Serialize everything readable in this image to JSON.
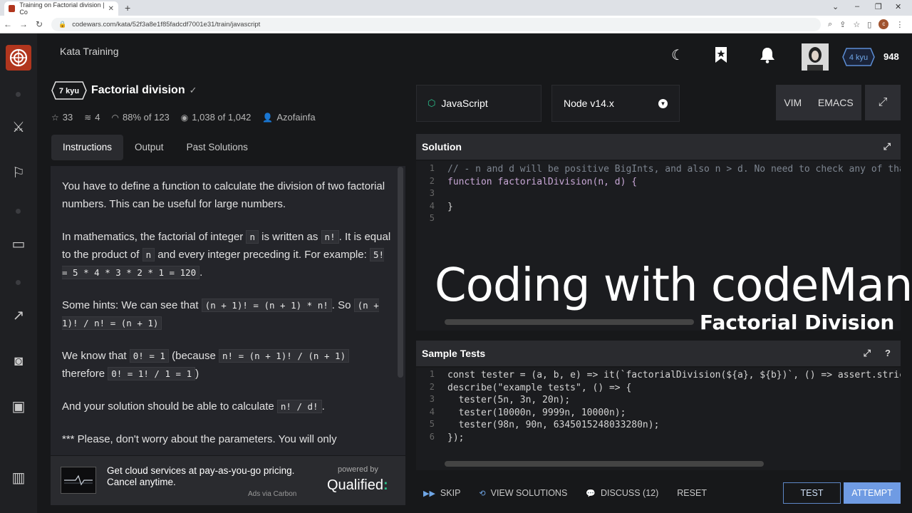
{
  "browser": {
    "tab_title": "Training on Factorial division | Co",
    "url": "codewars.com/kata/52f3a8e1f85fadcdf7001e31/train/javascript",
    "profile_initial": "c"
  },
  "header": {
    "section_title": "Kata Training",
    "rank": "4 kyu",
    "honor": "948"
  },
  "kata": {
    "kyu": "7 kyu",
    "title": "Factorial division",
    "stats": {
      "stars": "33",
      "collections": "4",
      "satisfaction": "88% of 123",
      "completed": "1,038 of 1,042",
      "author": "Azofainfa"
    },
    "tabs": [
      "Instructions",
      "Output",
      "Past Solutions"
    ]
  },
  "instructions": {
    "p1": "You have to define a function to calculate the division of two factorial numbers. This can be useful for large numbers.",
    "p2_a": "In mathematics, the factorial of integer",
    "p2_code1": "n",
    "p2_b": "is written as",
    "p2_code2": "n!",
    "p2_c": ". It is equal to the product of",
    "p2_code3": "n",
    "p2_d": "and every integer preceding it. For example:",
    "p2_code4": "5! = 5 * 4 * 3 * 2 * 1 = 120",
    "p2_e": ".",
    "p3_a": "Some hints: We can see that",
    "p3_code1": "(n + 1)! = (n + 1) * n!",
    "p3_b": ". So",
    "p3_code2": "(n + 1)! / n! = (n + 1)",
    "p4_a": "We know that",
    "p4_code1": "0! = 1",
    "p4_b": "(because",
    "p4_code2": "n! = (n + 1)! / (n + 1)",
    "p4_c": "therefore",
    "p4_code3": "0! = 1! / 1 = 1",
    "p4_d": ")",
    "p5_a": "And your solution should be able to calculate",
    "p5_code1": "n! / d!",
    "p5_b": ".",
    "p6": "*** Please, don't worry about the parameters. You will only"
  },
  "ad": {
    "text_line1": "Get cloud services at pay-as-you-go pricing.",
    "text_line2": "Cancel anytime.",
    "via": "Ads via Carbon",
    "powered_by": "powered by",
    "brand": "Qualified",
    "brand_mark": ":"
  },
  "editor_toolbar": {
    "language": "JavaScript",
    "version": "Node v14.x",
    "mode_vim": "VIM",
    "mode_emacs": "EMACS"
  },
  "solution": {
    "heading": "Solution",
    "lines": [
      "// - n and d will be positive BigInts, and also n > d. No need to check any of that",
      "function factorialDivision(n, d) {",
      "",
      "}",
      ""
    ]
  },
  "sample_tests": {
    "heading": "Sample Tests",
    "line1": "const tester = (a, b, e) => it(`factorialDivision(${a}, ${b})`, () => assert.strict",
    "line2": "describe(\"example tests\", () => {",
    "line3": "  tester(5n, 3n, 20n);",
    "line4": "  tester(10000n, 9999n, 10000n);",
    "line5": "  tester(98n, 90n, 6345015248033280n);",
    "line6": "});"
  },
  "overlay": {
    "title": "Coding with codeManS",
    "subtitle": "Factorial Division"
  },
  "actions": {
    "skip": "SKIP",
    "view_solutions": "VIEW SOLUTIONS",
    "discuss": "DISCUSS (12)",
    "reset": "RESET",
    "test": "TEST",
    "attempt": "ATTEMPT"
  },
  "colors": {
    "brand_red": "#b1361e",
    "accent_green": "#2ac38d",
    "accent_blue": "#6f9be3"
  }
}
